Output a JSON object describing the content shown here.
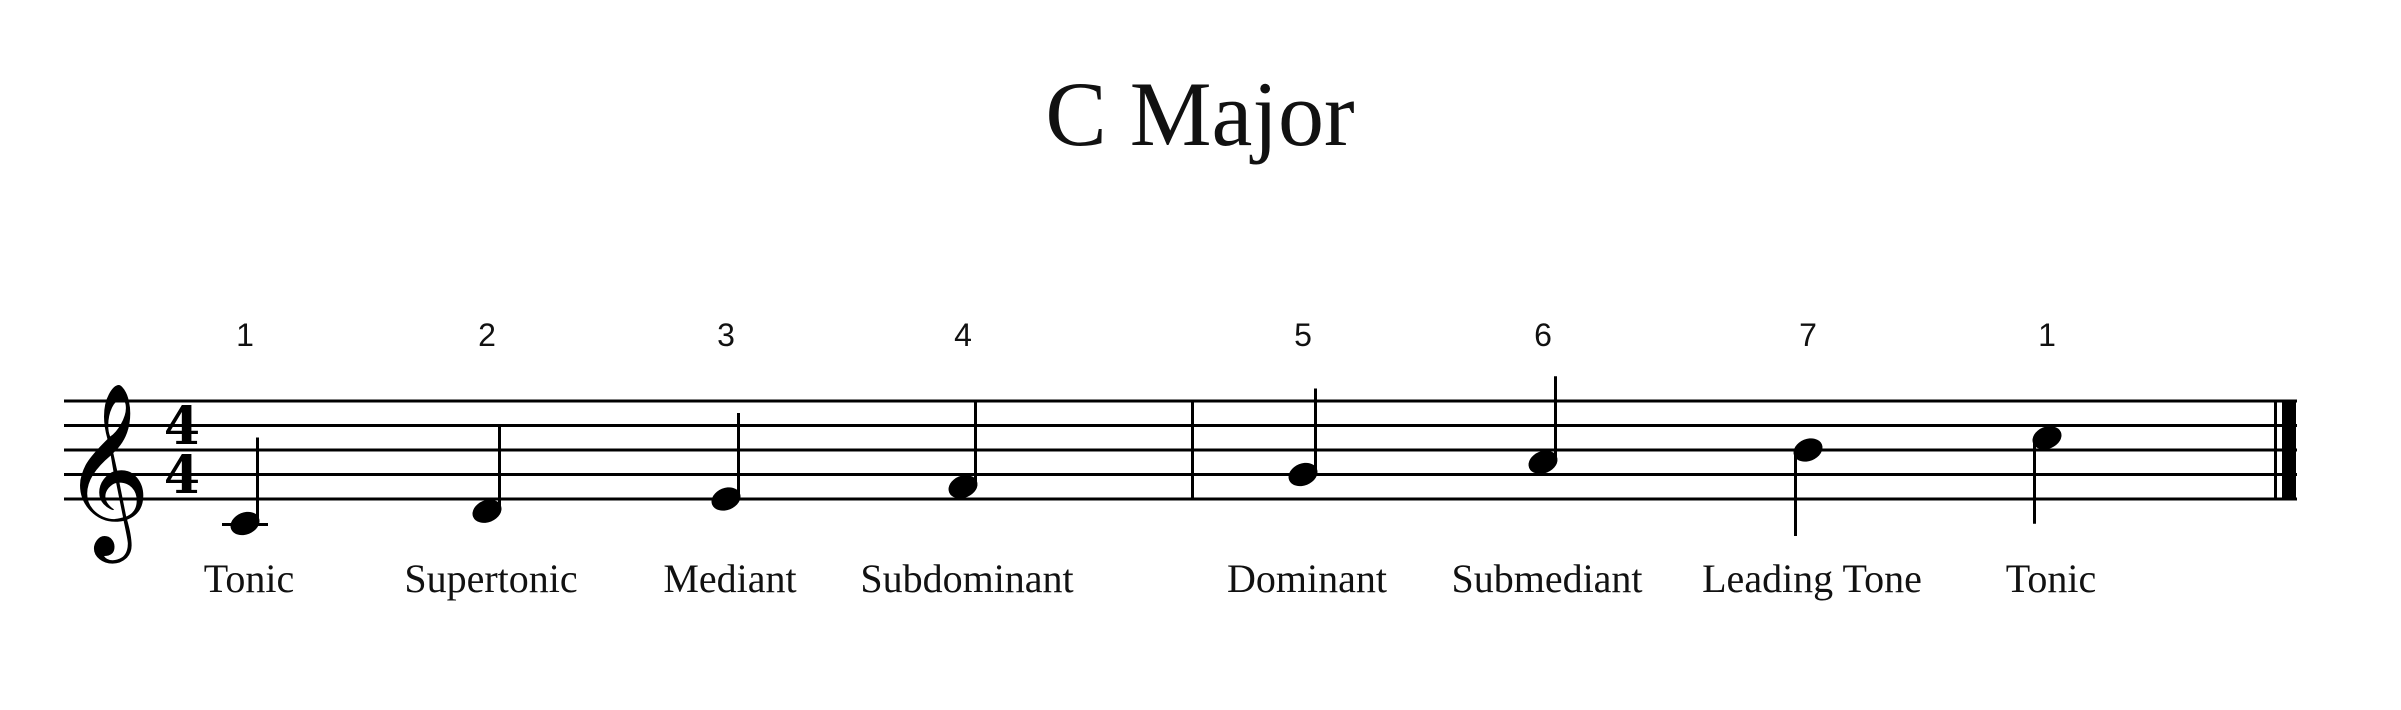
{
  "title": "C Major",
  "clef": "treble",
  "time_signature": {
    "top": "4",
    "bottom": "4"
  },
  "notes": [
    {
      "pitch": "C4",
      "degree": "1",
      "label": "Tonic"
    },
    {
      "pitch": "D4",
      "degree": "2",
      "label": "Supertonic"
    },
    {
      "pitch": "E4",
      "degree": "3",
      "label": "Mediant"
    },
    {
      "pitch": "F4",
      "degree": "4",
      "label": "Subdominant"
    },
    {
      "pitch": "G4",
      "degree": "5",
      "label": "Dominant"
    },
    {
      "pitch": "A4",
      "degree": "6",
      "label": "Submediant"
    },
    {
      "pitch": "B4",
      "degree": "7",
      "label": "Leading Tone"
    },
    {
      "pitch": "C5",
      "degree": "1",
      "label": "Tonic"
    }
  ],
  "note_value": "quarter",
  "measures": 2,
  "final_barline": "end"
}
